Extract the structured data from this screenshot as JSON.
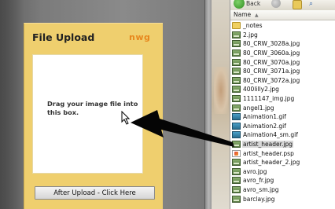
{
  "upload_panel": {
    "title": "File Upload",
    "logo": "nwg",
    "drop_text": "Drag your image file into this box.",
    "after_button": "After Upload - Click Here"
  },
  "explorer": {
    "toolbar": {
      "back_label": "Back"
    },
    "column_header": "Name",
    "files": [
      {
        "name": "_notes",
        "type": "folder"
      },
      {
        "name": "2.jpg",
        "type": "jpg"
      },
      {
        "name": "80_CRW_3028a.jpg",
        "type": "jpg"
      },
      {
        "name": "80_CRW_3060a.jpg",
        "type": "jpg"
      },
      {
        "name": "80_CRW_3070a.jpg",
        "type": "jpg"
      },
      {
        "name": "80_CRW_3071a.jpg",
        "type": "jpg"
      },
      {
        "name": "80_CRW_3072a.jpg",
        "type": "jpg"
      },
      {
        "name": "400lilly2.jpg",
        "type": "jpg"
      },
      {
        "name": "1111147_img.jpg",
        "type": "jpg"
      },
      {
        "name": "angel1.jpg",
        "type": "jpg"
      },
      {
        "name": "Animation1.gif",
        "type": "gif"
      },
      {
        "name": "Animation2.gif",
        "type": "gif"
      },
      {
        "name": "Animation4_sm.gif",
        "type": "gif"
      },
      {
        "name": "artist_header.jpg",
        "type": "jpg",
        "selected": true
      },
      {
        "name": "artist_header.psp",
        "type": "psp"
      },
      {
        "name": "artist_header_2.jpg",
        "type": "jpg"
      },
      {
        "name": "avro.jpg",
        "type": "jpg"
      },
      {
        "name": "avro_fr.jpg",
        "type": "jpg"
      },
      {
        "name": "avro_sm.jpg",
        "type": "jpg"
      },
      {
        "name": "barclay.jpg",
        "type": "jpg"
      }
    ]
  },
  "colors": {
    "panel_bg": "#efcf6e",
    "logo": "#e7871d",
    "selection": "#d8d8d8"
  }
}
